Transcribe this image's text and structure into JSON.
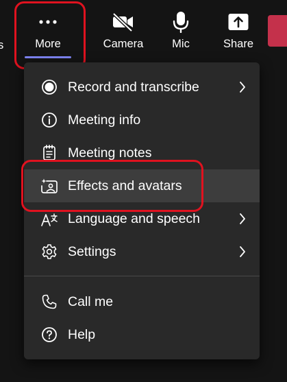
{
  "toolbar": {
    "partial_label": "s",
    "buttons": [
      {
        "label": "More",
        "icon": "more-icon"
      },
      {
        "label": "Camera",
        "icon": "camera-off-icon"
      },
      {
        "label": "Mic",
        "icon": "mic-icon"
      },
      {
        "label": "Share",
        "icon": "share-icon"
      }
    ]
  },
  "menu": {
    "items": [
      {
        "label": "Record and transcribe",
        "icon": "record-icon",
        "has_submenu": true
      },
      {
        "label": "Meeting info",
        "icon": "info-icon",
        "has_submenu": false
      },
      {
        "label": "Meeting notes",
        "icon": "notes-icon",
        "has_submenu": false
      },
      {
        "label": "Effects and avatars",
        "icon": "effects-icon",
        "has_submenu": false,
        "highlighted": true
      },
      {
        "label": "Language and speech",
        "icon": "language-icon",
        "has_submenu": true
      },
      {
        "label": "Settings",
        "icon": "settings-gear-icon",
        "has_submenu": true
      },
      {
        "label": "Call me",
        "icon": "phone-icon",
        "has_submenu": false
      },
      {
        "label": "Help",
        "icon": "help-icon",
        "has_submenu": false
      }
    ]
  },
  "colors": {
    "background": "#141414",
    "menu_background": "#292929",
    "hover_background": "#3d3d3d",
    "accent_underline": "#7f85f5",
    "annotation_red": "#e0121f",
    "leave_button_red": "#c4314b"
  }
}
